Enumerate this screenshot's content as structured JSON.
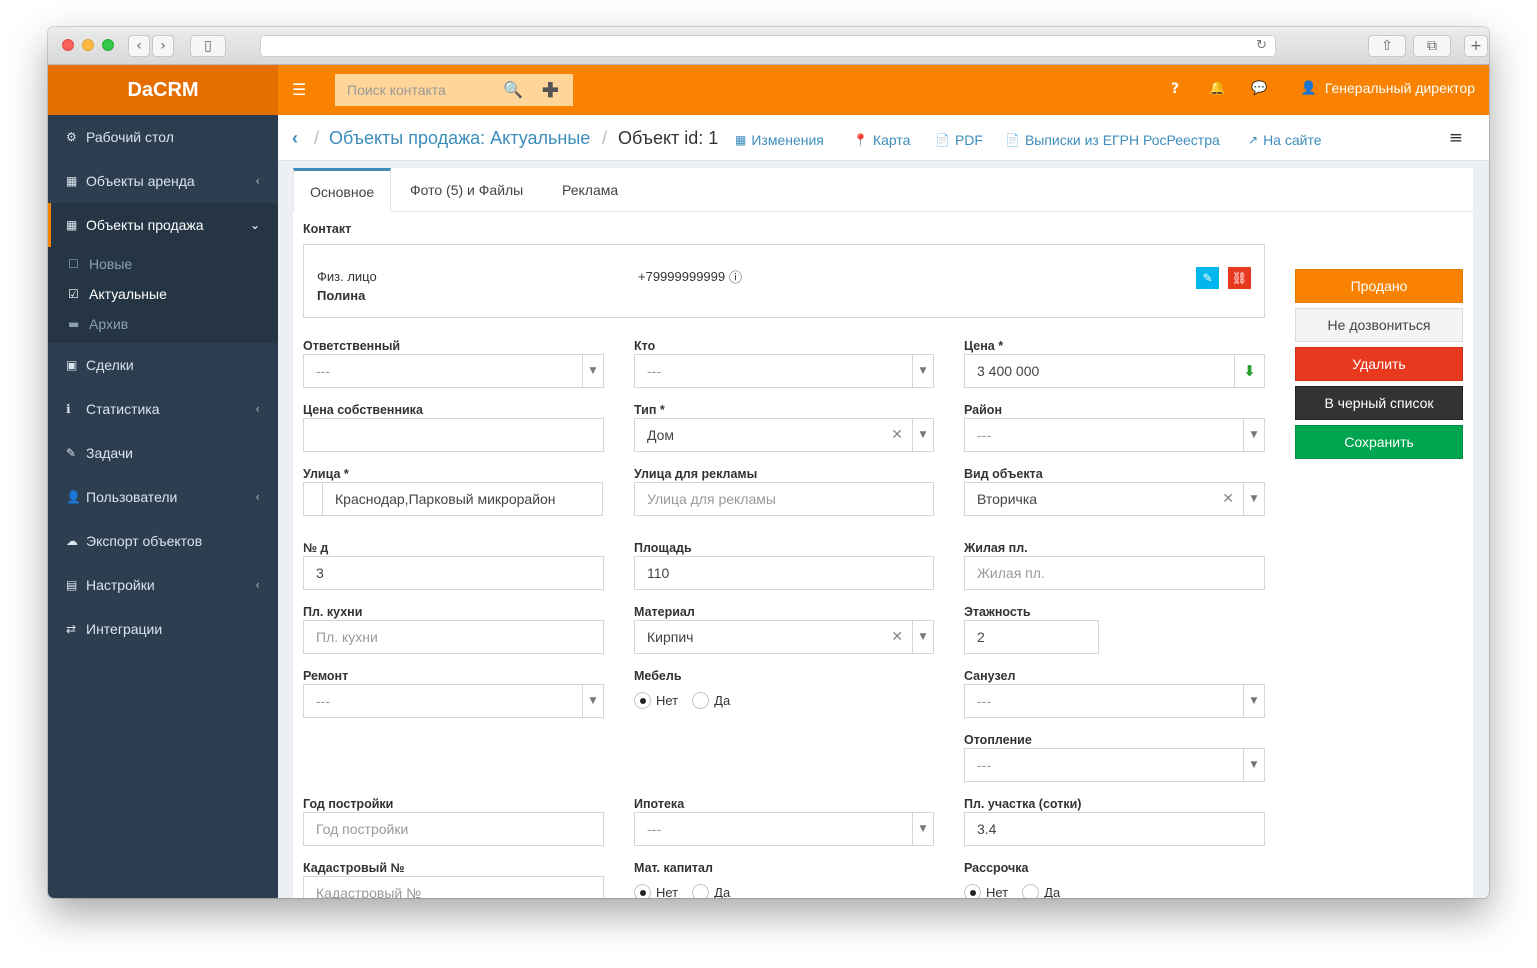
{
  "browser": {
    "url": "",
    "buttons": {
      "back": "‹",
      "forward": "›",
      "sidebar": "▯",
      "share": "⇧",
      "tabs": "⧉",
      "new_tab": "+"
    }
  },
  "app": {
    "logo": "DaCRM"
  },
  "topbar": {
    "menu_icon": "☰",
    "search_placeholder": "Поиск контакта",
    "search_icon": "🔍",
    "add_icon": "✚",
    "help": "?",
    "bell": "🔔",
    "chat": "💬",
    "user_icon": "👤",
    "user_name": "Генеральный директор"
  },
  "sidebar": {
    "items": [
      {
        "icon": "⚙",
        "label": "Рабочий стол"
      },
      {
        "icon": "▦",
        "label": "Объекты аренда",
        "chevron": "‹"
      },
      {
        "icon": "▦",
        "label": "Объекты продажа",
        "chevron": "⌄"
      },
      {
        "icon": "▣",
        "label": "Сделки"
      },
      {
        "icon": "ℹ",
        "label": "Статистика",
        "chevron": "‹"
      },
      {
        "icon": "✎",
        "label": "Задачи"
      },
      {
        "icon": "👤",
        "label": "Пользователи",
        "chevron": "‹"
      },
      {
        "icon": "☁",
        "label": "Экспорт объектов"
      },
      {
        "icon": "▤",
        "label": "Настройки",
        "chevron": "‹"
      },
      {
        "icon": "⇄",
        "label": "Интеграции"
      }
    ],
    "submenu": [
      {
        "icon": "☐",
        "label": "Новые"
      },
      {
        "icon": "☑",
        "label": "Актуальные"
      },
      {
        "icon": "▬",
        "label": "Архив"
      }
    ]
  },
  "breadcrumb": {
    "back": "‹",
    "parent": "Объекты продажа: Актуальные",
    "sep": "/",
    "current": "Объект id: 1"
  },
  "toolbar": [
    {
      "icon": "▦",
      "label": "Изменения"
    },
    {
      "icon": "📍",
      "label": "Карта"
    },
    {
      "icon": "📄",
      "label": "PDF"
    },
    {
      "icon": "📄",
      "label": "Выписки из ЕГРН РосРеестра"
    },
    {
      "icon": "↗",
      "label": "На сайте"
    }
  ],
  "menu_right": "≡",
  "tabs": [
    "Основное",
    "Фото (5) и Файлы",
    "Реклама"
  ],
  "contact": {
    "label": "Контакт",
    "type": "Физ. лицо",
    "name": "Полина",
    "phone": "+79999999999",
    "phone_info": "ⓘ",
    "edit_icon": "✎",
    "unlink_icon": "⛓"
  },
  "form": {
    "responsible": {
      "label": "Ответственный",
      "value": "---"
    },
    "who": {
      "label": "Кто",
      "value": "---"
    },
    "price": {
      "label": "Цена *",
      "value": "3 400 000",
      "addon": "⬇"
    },
    "owner_price": {
      "label": "Цена собственника",
      "value": ""
    },
    "type": {
      "label": "Тип *",
      "value": "Дом"
    },
    "district": {
      "label": "Район",
      "value": "---"
    },
    "street": {
      "label": "Улица *",
      "value": "Краснодар,Парковый микрорайон"
    },
    "ad_street": {
      "label": "Улица для рекламы",
      "placeholder": "Улица для рекламы"
    },
    "object_kind": {
      "label": "Вид объекта",
      "value": "Вторичка"
    },
    "house_no": {
      "label": "№ д",
      "value": "3"
    },
    "area": {
      "label": "Площадь",
      "value": "110"
    },
    "living_area": {
      "label": "Жилая пл.",
      "placeholder": "Жилая пл."
    },
    "kitchen": {
      "label": "Пл. кухни",
      "placeholder": "Пл. кухни"
    },
    "material": {
      "label": "Материал",
      "value": "Кирпич"
    },
    "floors": {
      "label": "Этажность",
      "value": "2"
    },
    "repair": {
      "label": "Ремонт",
      "value": "---"
    },
    "furniture": {
      "label": "Мебель",
      "no": "Нет",
      "yes": "Да"
    },
    "bathroom": {
      "label": "Санузел",
      "value": "---"
    },
    "heating": {
      "label": "Отопление",
      "value": "---"
    },
    "build_year": {
      "label": "Год постройки",
      "placeholder": "Год постройки"
    },
    "mortgage": {
      "label": "Ипотека",
      "value": "---"
    },
    "plot_area": {
      "label": "Пл. участка (сотки)",
      "value": "3.4"
    },
    "cadastral": {
      "label": "Кадастровый №",
      "placeholder": "Кадастровый №"
    },
    "mat_capital": {
      "label": "Мат. капитал",
      "no": "Нет",
      "yes": "Да"
    },
    "installment": {
      "label": "Рассрочка",
      "no": "Нет",
      "yes": "Да"
    },
    "clear_icon": "✕",
    "caret_icon": "▼"
  },
  "actions": {
    "sold": "Продано",
    "no_answer": "Не дозвониться",
    "delete": "Удалить",
    "blacklist": "В черный список",
    "save": "Сохранить"
  },
  "colors": {
    "accent": "#f98200",
    "logo_bg": "#e66e00",
    "sidebar": "#2c3e50",
    "link": "#3c8dbc",
    "danger": "#e8391f",
    "success": "#00a54f",
    "dark": "#333333"
  }
}
